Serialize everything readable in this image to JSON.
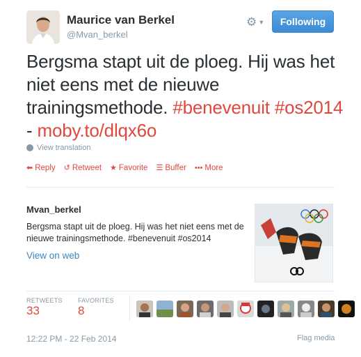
{
  "author": {
    "name": "Maurice van Berkel",
    "handle": "@Mvan_berkel"
  },
  "header": {
    "gear_icon": "gear-icon",
    "follow_label": "Following",
    "accent_color": "#3b88c3"
  },
  "tweet": {
    "text_plain": "Bergsma stapt uit de ploeg. Hij was het niet eens met de nieuwe trainingsmethode.",
    "hashtag1": "#benevenuit",
    "hashtag2": "#os2014",
    "separator": "-",
    "link": "moby.to/dlqx6o",
    "link_color": "#e0483e"
  },
  "translate_label": "View translation",
  "actions": [
    {
      "label": "Reply",
      "icon": "reply-icon"
    },
    {
      "label": "Retweet",
      "icon": "retweet-icon"
    },
    {
      "label": "Favorite",
      "icon": "star-icon"
    },
    {
      "label": "Buffer",
      "icon": "buffer-icon"
    },
    {
      "label": "More",
      "icon": "more-icon"
    }
  ],
  "card": {
    "username": "Mvan_berkel",
    "text": "Bergsma stapt uit de ploeg. Hij was het niet eens met de nieuwe trainingsmethode. #benevenuit #os2014",
    "link_label": "View on web"
  },
  "stats": {
    "retweets_label": "RETWEETS",
    "retweets_value": "33",
    "favorites_label": "FAVORITES",
    "favorites_value": "8"
  },
  "footer": {
    "timestamp": "12:22 PM - 22 Feb 2014",
    "flag_label": "Flag media"
  }
}
